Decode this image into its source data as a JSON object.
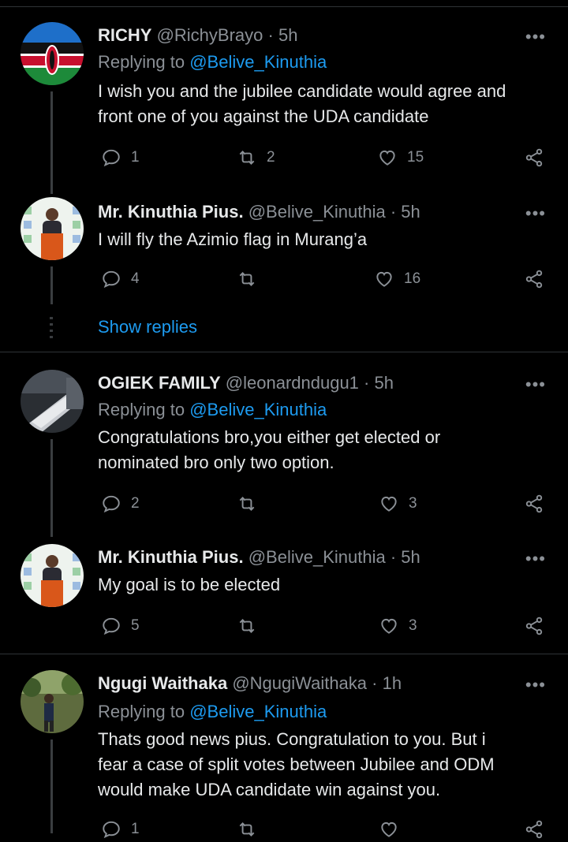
{
  "tweets": [
    {
      "name": "RICHY",
      "handle": "@RichyBrayo",
      "time": "5h",
      "replying_label": "Replying to",
      "replying_to": "@Belive_Kinuthia",
      "text_lines": [
        "I wish you and the jubilee candidate would agree and",
        "front one of you against the UDA candidate"
      ],
      "replies": "1",
      "retweets": "2",
      "likes": "15"
    },
    {
      "name": "Mr. Kinuthia Pius.",
      "handle": "@Belive_Kinuthia",
      "time": "5h",
      "text_lines": [
        "I will fly the Azimio flag in Murang’a"
      ],
      "replies": "4",
      "retweets": "",
      "likes": "16"
    },
    {
      "name": "OGIEK FAMILY",
      "handle": "@leonardndugu1",
      "time": "5h",
      "replying_label": "Replying to",
      "replying_to": "@Belive_Kinuthia",
      "text_lines": [
        "Congratulations bro,you either get elected or",
        "nominated bro only two option."
      ],
      "replies": "2",
      "retweets": "",
      "likes": "3"
    },
    {
      "name": "Mr. Kinuthia Pius.",
      "handle": "@Belive_Kinuthia",
      "time": "5h",
      "text_lines": [
        "My goal is to be elected"
      ],
      "replies": "5",
      "retweets": "",
      "likes": "3"
    },
    {
      "name": "Ngugi Waithaka",
      "handle": "@NgugiWaithaka",
      "time": "1h",
      "replying_label": "Replying to",
      "replying_to": "@Belive_Kinuthia",
      "text_lines": [
        "Thats good news pius. Congratulation to you. But i",
        "fear a case of split votes between Jubilee and ODM",
        "would make UDA candidate win against you."
      ],
      "replies": "1",
      "retweets": "",
      "likes": ""
    }
  ],
  "show_replies": "Show replies",
  "separator": "·",
  "more_glyph": "•••",
  "colors": {
    "link": "#1d9bf0",
    "muted": "#8b9096",
    "text": "#e7e9ea",
    "background": "#000000"
  },
  "icons": [
    "reply-icon",
    "retweet-icon",
    "like-icon",
    "share-icon",
    "more-icon"
  ]
}
